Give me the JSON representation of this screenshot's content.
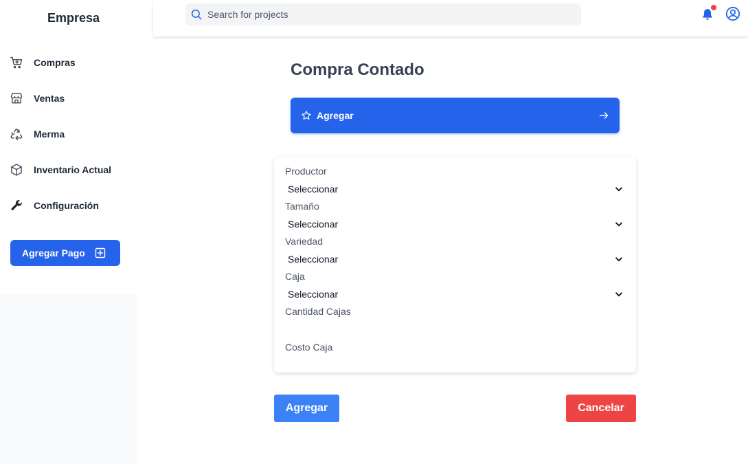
{
  "brand": "Empresa",
  "sidebar": {
    "items": [
      {
        "label": "Compras",
        "icon": "cart-icon"
      },
      {
        "label": "Ventas",
        "icon": "store-icon"
      },
      {
        "label": "Merma",
        "icon": "recycle-icon"
      },
      {
        "label": "Inventario Actual",
        "icon": "box-icon"
      },
      {
        "label": "Configuración",
        "icon": "wrench-icon"
      }
    ],
    "pay_button_label": "Agregar Pago"
  },
  "header": {
    "search_placeholder": "Search for projects"
  },
  "main": {
    "title": "Compra Contado",
    "banner_label": "Agregar",
    "form": {
      "fields": [
        {
          "label": "Productor",
          "value": "Seleccionar"
        },
        {
          "label": "Tamaño",
          "value": "Seleccionar"
        },
        {
          "label": "Variedad",
          "value": "Seleccionar"
        },
        {
          "label": "Caja",
          "value": "Seleccionar"
        }
      ],
      "cantidad_label": "Cantidad Cajas",
      "costo_label": "Costo Caja"
    },
    "add_button": "Agregar",
    "cancel_button": "Cancelar"
  },
  "colors": {
    "primary": "#2563eb",
    "add_button": "#3b82f6",
    "cancel_button": "#ef4444",
    "notification_dot": "#ef4444"
  }
}
